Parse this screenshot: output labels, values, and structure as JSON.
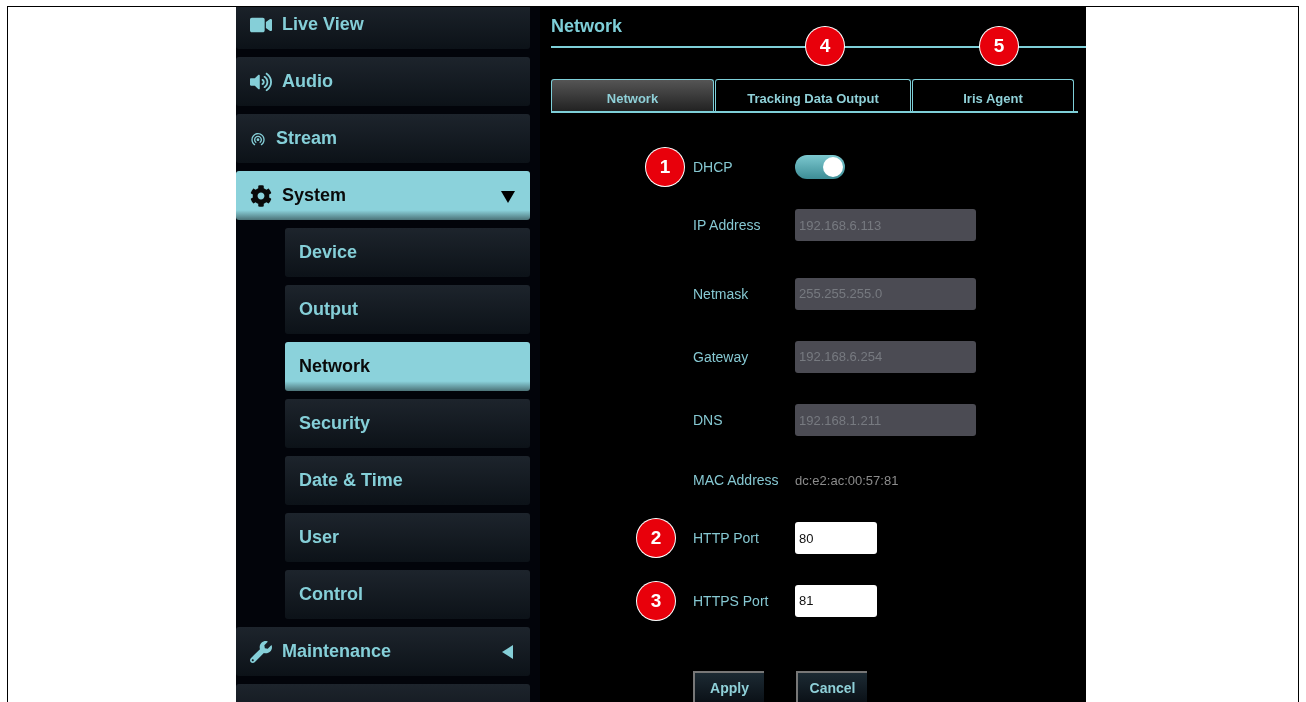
{
  "sidebar": {
    "items": [
      {
        "label": "Live View",
        "selected": false
      },
      {
        "label": "Audio",
        "selected": false
      },
      {
        "label": "Stream",
        "selected": false
      },
      {
        "label": "System",
        "selected": true,
        "expanded": true,
        "children": [
          {
            "label": "Device",
            "selected": false
          },
          {
            "label": "Output",
            "selected": false
          },
          {
            "label": "Network",
            "selected": true
          },
          {
            "label": "Security",
            "selected": false
          },
          {
            "label": "Date & Time",
            "selected": false
          },
          {
            "label": "User",
            "selected": false
          },
          {
            "label": "Control",
            "selected": false
          }
        ]
      },
      {
        "label": "Maintenance",
        "selected": false,
        "expanded": false
      }
    ]
  },
  "page_title": "Network",
  "tabs": [
    {
      "label": "Network",
      "selected": true
    },
    {
      "label": "Tracking Data Output",
      "selected": false,
      "callout": "4"
    },
    {
      "label": "Iris Agent",
      "selected": false,
      "callout": "5"
    }
  ],
  "form": {
    "rows": [
      {
        "kind": "toggle",
        "label": "DHCP",
        "on": true,
        "callout": "1"
      },
      {
        "kind": "field",
        "label": "IP Address",
        "value": "192.168.6.113",
        "disabled": true
      },
      {
        "kind": "field",
        "label": "Netmask",
        "value": "255.255.255.0",
        "disabled": true
      },
      {
        "kind": "field",
        "label": "Gateway",
        "value": "192.168.6.254",
        "disabled": true
      },
      {
        "kind": "field",
        "label": "DNS",
        "value": "192.168.1.211",
        "disabled": true
      },
      {
        "kind": "text",
        "label": "MAC Address",
        "value": "dc:e2:ac:00:57:81"
      },
      {
        "kind": "port",
        "label": "HTTP Port",
        "value": "80",
        "disabled": false,
        "callout": "2"
      },
      {
        "kind": "port",
        "label": "HTTPS Port",
        "value": "81",
        "disabled": false,
        "callout": "3"
      }
    ],
    "buttons": [
      "Apply",
      "Cancel"
    ]
  }
}
